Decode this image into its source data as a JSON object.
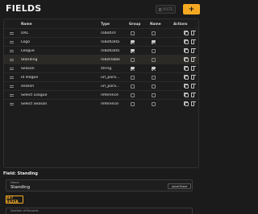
{
  "header": {
    "title": "FIELDS",
    "paste_label": "PASTE",
    "add_label": "+"
  },
  "table": {
    "columns": [
      "Name",
      "Type",
      "Group",
      "Name",
      "Actions"
    ],
    "rows": [
      {
        "name": "URL",
        "type": "robotUrl",
        "group": false,
        "name_flag": false,
        "selected": false
      },
      {
        "name": "Logo",
        "type": "robotData",
        "group": true,
        "name_flag": true,
        "selected": false
      },
      {
        "name": "League",
        "type": "robotData",
        "group": true,
        "name_flag": false,
        "selected": false
      },
      {
        "name": "Standing",
        "type": "robotTable",
        "group": false,
        "name_flag": false,
        "selected": true
      },
      {
        "name": "Season",
        "type": "string",
        "group": true,
        "name_flag": true,
        "selected": false
      },
      {
        "name": "id league",
        "type": "url_para...",
        "group": false,
        "name_flag": false,
        "selected": false
      },
      {
        "name": "season",
        "type": "url_para...",
        "group": false,
        "name_flag": false,
        "selected": false
      },
      {
        "name": "Select League",
        "type": "reference",
        "group": false,
        "name_flag": false,
        "selected": false
      },
      {
        "name": "Select Season",
        "type": "reference",
        "group": false,
        "name_flag": false,
        "selected": false
      }
    ]
  },
  "field": {
    "title": "Field: Standing",
    "name_label": "Name",
    "name_value": "Standing",
    "type_chip": "robotTable",
    "set_filter_label": "SET FILTER",
    "records_label": "Number of Records"
  },
  "colors": {
    "accent": "#f5a922",
    "background": "#1b1b1b"
  }
}
